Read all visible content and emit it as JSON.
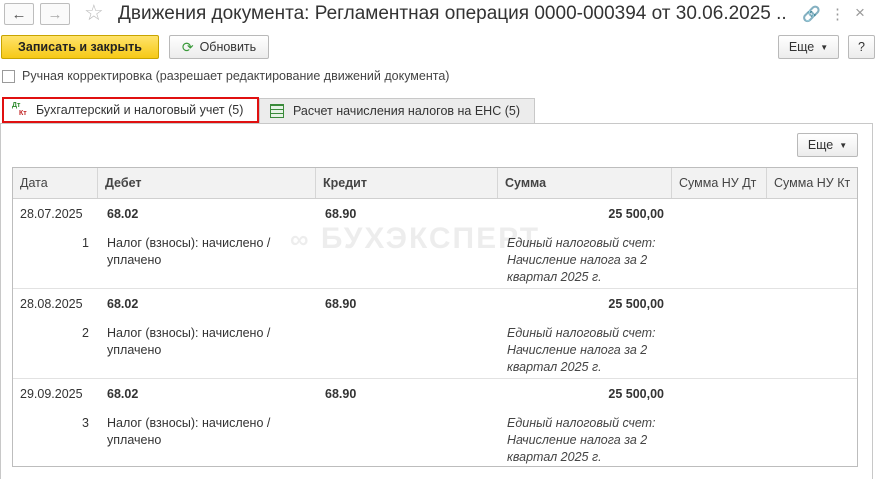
{
  "window": {
    "title": "Движения документа: Регламентная операция 0000-000394 от 30.06.2025 ..."
  },
  "toolbar": {
    "save_close_label": "Записать и закрыть",
    "refresh_label": "Обновить",
    "more_label": "Еще",
    "help_label": "?"
  },
  "manual_correction": {
    "checked": false,
    "label": "Ручная корректировка (разрешает редактирование движений документа)"
  },
  "tabs": [
    {
      "label": "Бухгалтерский и налоговый учет (5)",
      "icon": "dt-kt-icon",
      "active": true
    },
    {
      "label": "Расчет начисления налогов на ЕНС (5)",
      "icon": "table-icon",
      "active": false
    }
  ],
  "panel": {
    "more_label": "Еще"
  },
  "table": {
    "columns": [
      "Дата",
      "Дебет",
      "Кредит",
      "Сумма",
      "Сумма НУ Дт",
      "Сумма НУ Кт"
    ],
    "rows": [
      {
        "date": "28.07.2025",
        "num": "1",
        "debit": "68.02",
        "credit": "68.90",
        "sum": "25 500,00",
        "debit_desc_1": "Налог (взносы): начислено /",
        "debit_desc_2": "уплачено",
        "sum_desc_1": "Единый налоговый счет:",
        "sum_desc_2": "Начисление налога за 2",
        "sum_desc_3": "квартал 2025 г."
      },
      {
        "date": "28.08.2025",
        "num": "2",
        "debit": "68.02",
        "credit": "68.90",
        "sum": "25 500,00",
        "debit_desc_1": "Налог (взносы): начислено /",
        "debit_desc_2": "уплачено",
        "sum_desc_1": "Единый налоговый счет:",
        "sum_desc_2": "Начисление налога за 2",
        "sum_desc_3": "квартал 2025 г."
      },
      {
        "date": "29.09.2025",
        "num": "3",
        "debit": "68.02",
        "credit": "68.90",
        "sum": "25 500,00",
        "debit_desc_1": "Налог (взносы): начислено /",
        "debit_desc_2": "уплачено",
        "sum_desc_1": "Единый налоговый счет:",
        "sum_desc_2": "Начисление налога за 2",
        "sum_desc_3": "квартал 2025 г."
      }
    ]
  },
  "watermark": "БУХЭКСПЕРТ",
  "colors": {
    "primary_button": "#f6c916",
    "active_tab_outline": "#e01010",
    "refresh_icon": "#3a9a3a"
  }
}
